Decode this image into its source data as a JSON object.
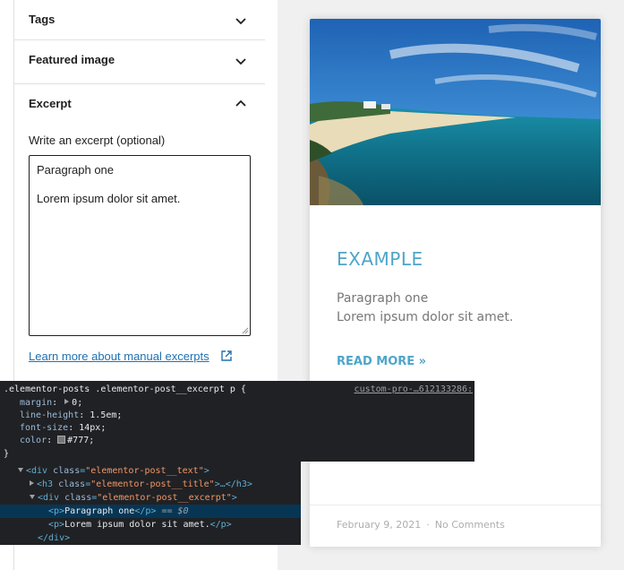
{
  "sidebar": {
    "panels": [
      {
        "label": "Tags",
        "icon": "chevron-down-icon"
      },
      {
        "label": "Featured image",
        "icon": "chevron-down-icon"
      },
      {
        "label": "Excerpt",
        "icon": "chevron-up-icon"
      }
    ],
    "excerpt": {
      "help_label": "Write an excerpt (optional)",
      "paragraph1": "Paragraph one",
      "paragraph2": "Lorem ipsum dolor sit amet.",
      "learn_more_link": "Learn more about manual excerpts",
      "link_icon": "external-link-icon"
    }
  },
  "preview": {
    "image_alt": "beach landscape",
    "title": "EXAMPLE",
    "excerpt_line1": "Paragraph one",
    "excerpt_line2": "Lorem ipsum dolor sit amet.",
    "read_more": "READ MORE »",
    "date": "February 9, 2021",
    "separator": "·",
    "comments": "No Comments",
    "accent_color": "#4ea5c8"
  },
  "devtools": {
    "styles": {
      "selector": ".elementor-posts .elementor-post__excerpt p {",
      "source": "custom-pro-…612133286:",
      "declarations": [
        {
          "prop": "margin",
          "value": "0;"
        },
        {
          "prop": "line-height",
          "value": "1.5em;"
        },
        {
          "prop": "font-size",
          "value": "14px;"
        },
        {
          "prop": "color",
          "value": "#777;"
        }
      ],
      "closing": "}"
    },
    "elements": {
      "line1": {
        "tag_open": "<div",
        "attr": "class",
        "value": "\"elementor-post__text\"",
        "tag_close": ">"
      },
      "line2": {
        "tag_open": "<h3",
        "attr": "class",
        "value": "\"elementor-post__title\"",
        "tag_close": ">…</h3>"
      },
      "line3": {
        "tag_open": "<div",
        "attr": "class",
        "value": "\"elementor-post__excerpt\"",
        "tag_close": ">"
      },
      "line4": {
        "open": "<p>",
        "text": "Paragraph one",
        "close": "</p>",
        "suffix": "== $0"
      },
      "line5": {
        "open": "<p>",
        "text": "Lorem ipsum dolor sit amet.",
        "close": "</p>"
      },
      "line6": {
        "close": "</div>"
      }
    }
  }
}
